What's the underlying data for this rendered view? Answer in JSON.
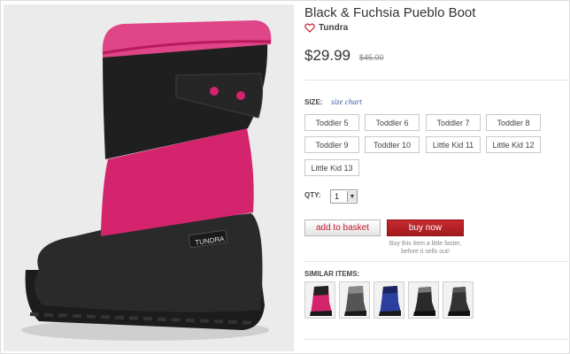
{
  "product": {
    "title": "Black & Fuchsia Pueblo Boot",
    "brand": "Tundra",
    "price": "$29.99",
    "original_price": "$45.00",
    "boot_label": "TUNDRA"
  },
  "size": {
    "label": "SIZE:",
    "chart_link": "size chart",
    "options": [
      "Toddler 5",
      "Toddler 6",
      "Toddler 7",
      "Toddler 8",
      "Toddler 9",
      "Toddler 10",
      "Little Kid 11",
      "Little Kid 12",
      "Little Kid 13"
    ]
  },
  "quantity": {
    "label": "QTY:",
    "value": "1"
  },
  "actions": {
    "add_to_basket": "add to basket",
    "buy_now": "buy now",
    "buy_note": "Buy this item a little faster, before it sells out!"
  },
  "similar": {
    "label": "SIMILAR ITEMS:",
    "items": [
      "pink-boot",
      "gray-boot",
      "blue-boot",
      "black-boot",
      "black-boot"
    ]
  },
  "colors": {
    "accent": "#c21a2b",
    "buy_button": "#b3222a",
    "boot_pink": "#d4246e",
    "boot_black": "#1f1f1f"
  }
}
